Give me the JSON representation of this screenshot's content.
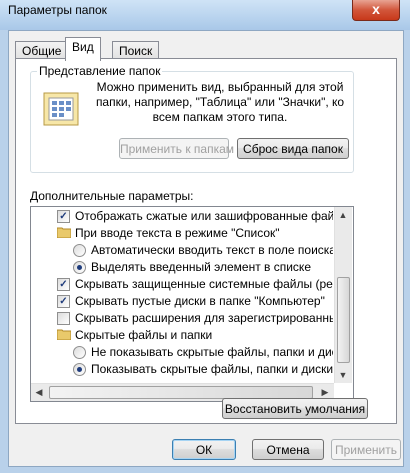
{
  "window": {
    "title": "Параметры папок",
    "close_glyph": "x"
  },
  "tabs": [
    {
      "label": "Общие"
    },
    {
      "label": "Вид"
    },
    {
      "label": "Поиск"
    }
  ],
  "folder_views": {
    "group_title": "Представление папок",
    "description": "Можно применить вид, выбранный для этой папки, например, \"Таблица\" или \"Значки\", ко всем папкам этого типа.",
    "apply_button": "Применить к папкам",
    "reset_button": "Сброс вида папок"
  },
  "advanced": {
    "label": "Дополнительные параметры:",
    "items": [
      {
        "type": "checkbox",
        "checked": true,
        "text": "Отображать сжатые или зашифрованные файлы NTFS"
      },
      {
        "type": "folder",
        "text": "При вводе текста в режиме \"Список\""
      },
      {
        "type": "radio",
        "checked": false,
        "text": "Автоматически вводить текст в поле поиска"
      },
      {
        "type": "radio",
        "checked": true,
        "text": "Выделять введенный элемент в списке"
      },
      {
        "type": "checkbox",
        "checked": true,
        "text": "Скрывать защищенные системные файлы (рекомендуется)"
      },
      {
        "type": "checkbox",
        "checked": true,
        "text": "Скрывать пустые диски в папке \"Компьютер\""
      },
      {
        "type": "checkbox",
        "checked": false,
        "text": "Скрывать расширения для зарегистрированных типов файлов"
      },
      {
        "type": "folder",
        "text": "Скрытые файлы и папки"
      },
      {
        "type": "radio",
        "checked": false,
        "text": "Не показывать скрытые файлы, папки и диски"
      },
      {
        "type": "radio",
        "checked": true,
        "text": "Показывать скрытые файлы, папки и диски"
      }
    ],
    "restore_button": "Восстановить умолчания"
  },
  "footer": {
    "ok": "ОК",
    "cancel": "Отмена",
    "apply": "Применить"
  },
  "colors": {
    "accent": "#3c7fb1",
    "check": "#1f3c7c",
    "titlebar": "#b9d1ea"
  }
}
